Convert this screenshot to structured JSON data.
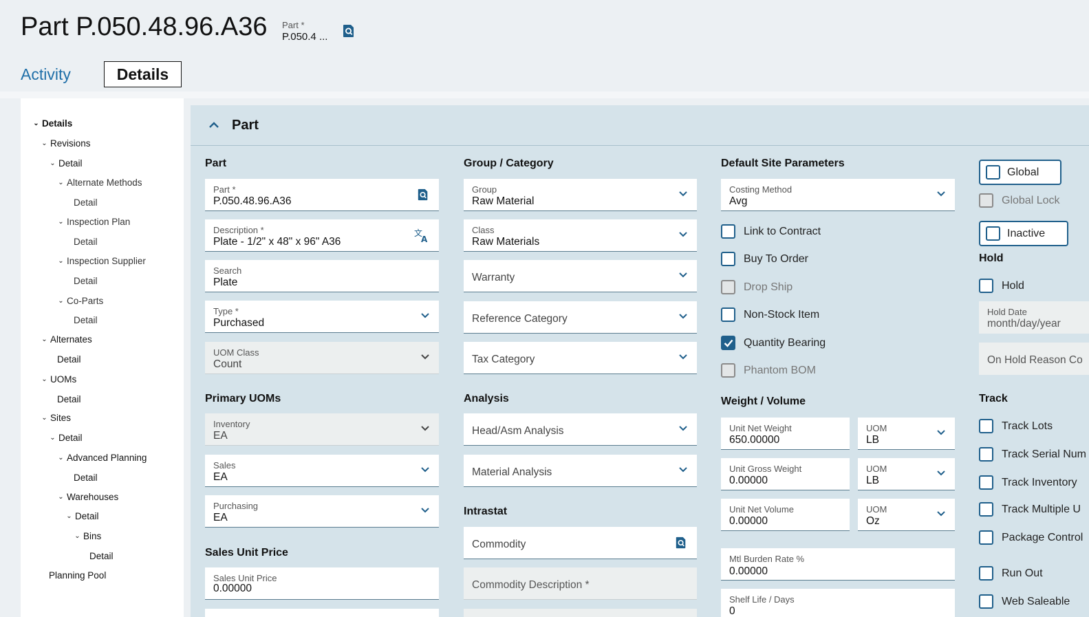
{
  "header": {
    "title": "Part P.050.48.96.A36",
    "part_field_label": "Part *",
    "part_field_value": "P.050.4 ..."
  },
  "tabs": {
    "activity": "Activity",
    "details": "Details"
  },
  "tree": {
    "details": "Details",
    "revisions": "Revisions",
    "rev_detail": "Detail",
    "alternate_methods": "Alternate Methods",
    "alt_methods_detail": "Detail",
    "inspection_plan": "Inspection Plan",
    "insp_plan_detail": "Detail",
    "inspection_supplier": "Inspection Supplier",
    "insp_supplier_detail": "Detail",
    "co_parts": "Co-Parts",
    "co_parts_detail": "Detail",
    "alternates": "Alternates",
    "alternates_detail": "Detail",
    "uoms": "UOMs",
    "uoms_detail": "Detail",
    "sites": "Sites",
    "sites_detail": "Detail",
    "advanced_planning": "Advanced Planning",
    "adv_planning_detail": "Detail",
    "warehouses": "Warehouses",
    "warehouses_detail": "Detail",
    "bins": "Bins",
    "bins_detail": "Detail",
    "planning_pool": "Planning Pool"
  },
  "section": {
    "title": "Part"
  },
  "col1": {
    "title": "Part",
    "part": {
      "label": "Part *",
      "value": "P.050.48.96.A36"
    },
    "description": {
      "label": "Description *",
      "value": "Plate - 1/2\" x 48\" x 96\" A36"
    },
    "search": {
      "label": "Search",
      "value": "Plate"
    },
    "type": {
      "label": "Type *",
      "value": "Purchased"
    },
    "uom_class": {
      "label": "UOM Class",
      "value": "Count"
    },
    "primary_uoms_title": "Primary UOMs",
    "inventory": {
      "label": "Inventory",
      "value": "EA"
    },
    "sales": {
      "label": "Sales",
      "value": "EA"
    },
    "purchasing": {
      "label": "Purchasing",
      "value": "EA"
    },
    "sales_unit_price_title": "Sales Unit Price",
    "sales_unit_price": {
      "label": "Sales Unit Price",
      "value": "0.00000"
    }
  },
  "col2": {
    "title": "Group / Category",
    "group": {
      "label": "Group",
      "value": "Raw Material"
    },
    "class": {
      "label": "Class",
      "value": "Raw Materials"
    },
    "warranty": "Warranty",
    "reference_category": "Reference Category",
    "tax_category": "Tax Category",
    "analysis_title": "Analysis",
    "head_asm_analysis": "Head/Asm Analysis",
    "material_analysis": "Material Analysis",
    "intrastat_title": "Intrastat",
    "commodity": "Commodity",
    "commodity_description": "Commodity Description *"
  },
  "col3": {
    "title": "Default Site Parameters",
    "costing_method": {
      "label": "Costing Method",
      "value": "Avg"
    },
    "checkboxes": {
      "link_to_contract": "Link to Contract",
      "buy_to_order": "Buy To Order",
      "drop_ship": "Drop Ship",
      "non_stock_item": "Non-Stock Item",
      "quantity_bearing": "Quantity Bearing",
      "phantom_bom": "Phantom BOM"
    },
    "weight_volume_title": "Weight / Volume",
    "unit_net_weight": {
      "label": "Unit Net Weight",
      "value": "650.00000"
    },
    "uom1": {
      "label": "UOM",
      "value": "LB"
    },
    "unit_gross_weight": {
      "label": "Unit Gross Weight",
      "value": "0.00000"
    },
    "uom2": {
      "label": "UOM",
      "value": "LB"
    },
    "unit_net_volume": {
      "label": "Unit Net Volume",
      "value": "0.00000"
    },
    "uom3": {
      "label": "UOM",
      "value": "Oz"
    },
    "mtl_burden_rate": {
      "label": "Mtl Burden Rate %",
      "value": "0.00000"
    },
    "shelf_life": {
      "label": "Shelf Life / Days",
      "value": "0"
    }
  },
  "col4": {
    "global": "Global",
    "global_lock": "Global Lock",
    "inactive": "Inactive",
    "hold_title": "Hold",
    "hold": "Hold",
    "hold_date": {
      "label": "Hold Date",
      "value": "month/day/year"
    },
    "on_hold_reason": "On Hold Reason Co",
    "track_title": "Track",
    "track_lots": "Track Lots",
    "track_serial": "Track Serial Num",
    "track_inventory": "Track Inventory",
    "track_multiple": "Track Multiple U",
    "package_control": "Package Control",
    "run_out": "Run Out",
    "web_saleable": "Web Saleable"
  },
  "colors": {
    "accent": "#1f5f8b",
    "link": "#1f6fa8",
    "panel": "#d5e3ea",
    "page_bg": "#ecf0f3"
  },
  "icons": [
    "search-icon",
    "translate-icon",
    "chevron-down-icon",
    "chevron-up-icon",
    "checkmark-icon"
  ]
}
